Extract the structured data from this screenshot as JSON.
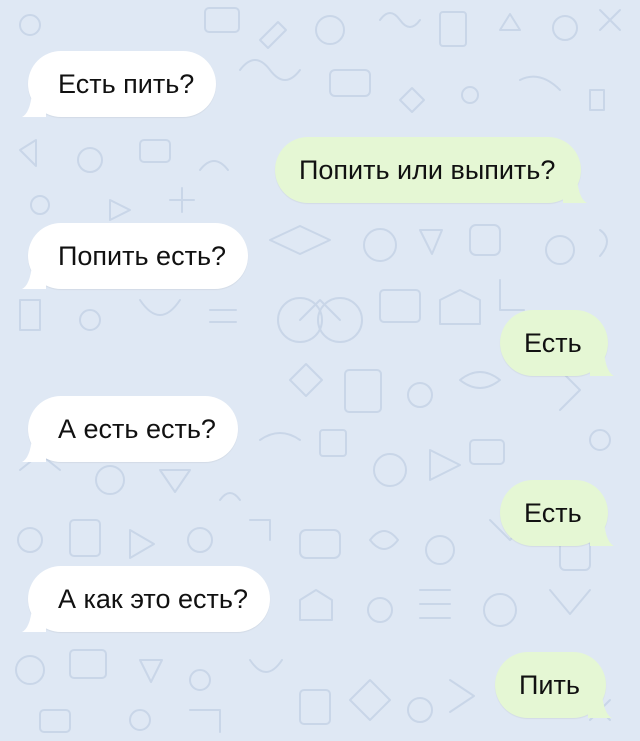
{
  "colors": {
    "background": "#dfe8f4",
    "incoming_bubble": "#ffffff",
    "outgoing_bubble": "#e5f7d4",
    "text": "#111111",
    "doodle": "#c9d6e8"
  },
  "messages": [
    {
      "direction": "incoming",
      "text": "Есть пить?"
    },
    {
      "direction": "outgoing",
      "text": "Попить или выпить?"
    },
    {
      "direction": "incoming",
      "text": "Попить есть?"
    },
    {
      "direction": "outgoing",
      "text": "Есть"
    },
    {
      "direction": "incoming",
      "text": "А есть есть?"
    },
    {
      "direction": "outgoing",
      "text": "Есть"
    },
    {
      "direction": "incoming",
      "text": "А как это есть?"
    },
    {
      "direction": "outgoing",
      "text": "Пить"
    }
  ]
}
